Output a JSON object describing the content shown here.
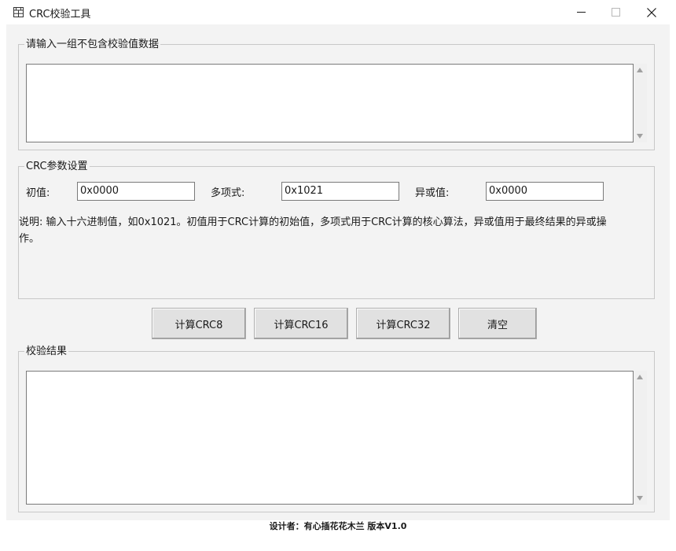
{
  "window": {
    "title": "CRC校验工具",
    "icons": {
      "app": "calculator-icon",
      "minimize": "minimize-icon",
      "maximize": "maximize-icon",
      "close": "close-icon"
    }
  },
  "input_group": {
    "legend": "请输入一组不包含校验值数据",
    "value": ""
  },
  "params_group": {
    "legend": "CRC参数设置",
    "init_label": "初值:",
    "init_value": "0x0000",
    "poly_label": "多项式:",
    "poly_value": "0x1021",
    "xor_label": "异或值:",
    "xor_value": "0x0000",
    "description": "说明: 输入十六进制值，如0x1021。初值用于CRC计算的初始值，多项式用于CRC计算的核心算法，异或值用于最终结果的异或操作。"
  },
  "buttons": {
    "crc8": "计算CRC8",
    "crc16": "计算CRC16",
    "crc32": "计算CRC32",
    "clear": "清空"
  },
  "result_group": {
    "legend": "校验结果",
    "value": ""
  },
  "footer": {
    "text": "设计者：有心插花花木兰    版本V1.0"
  }
}
